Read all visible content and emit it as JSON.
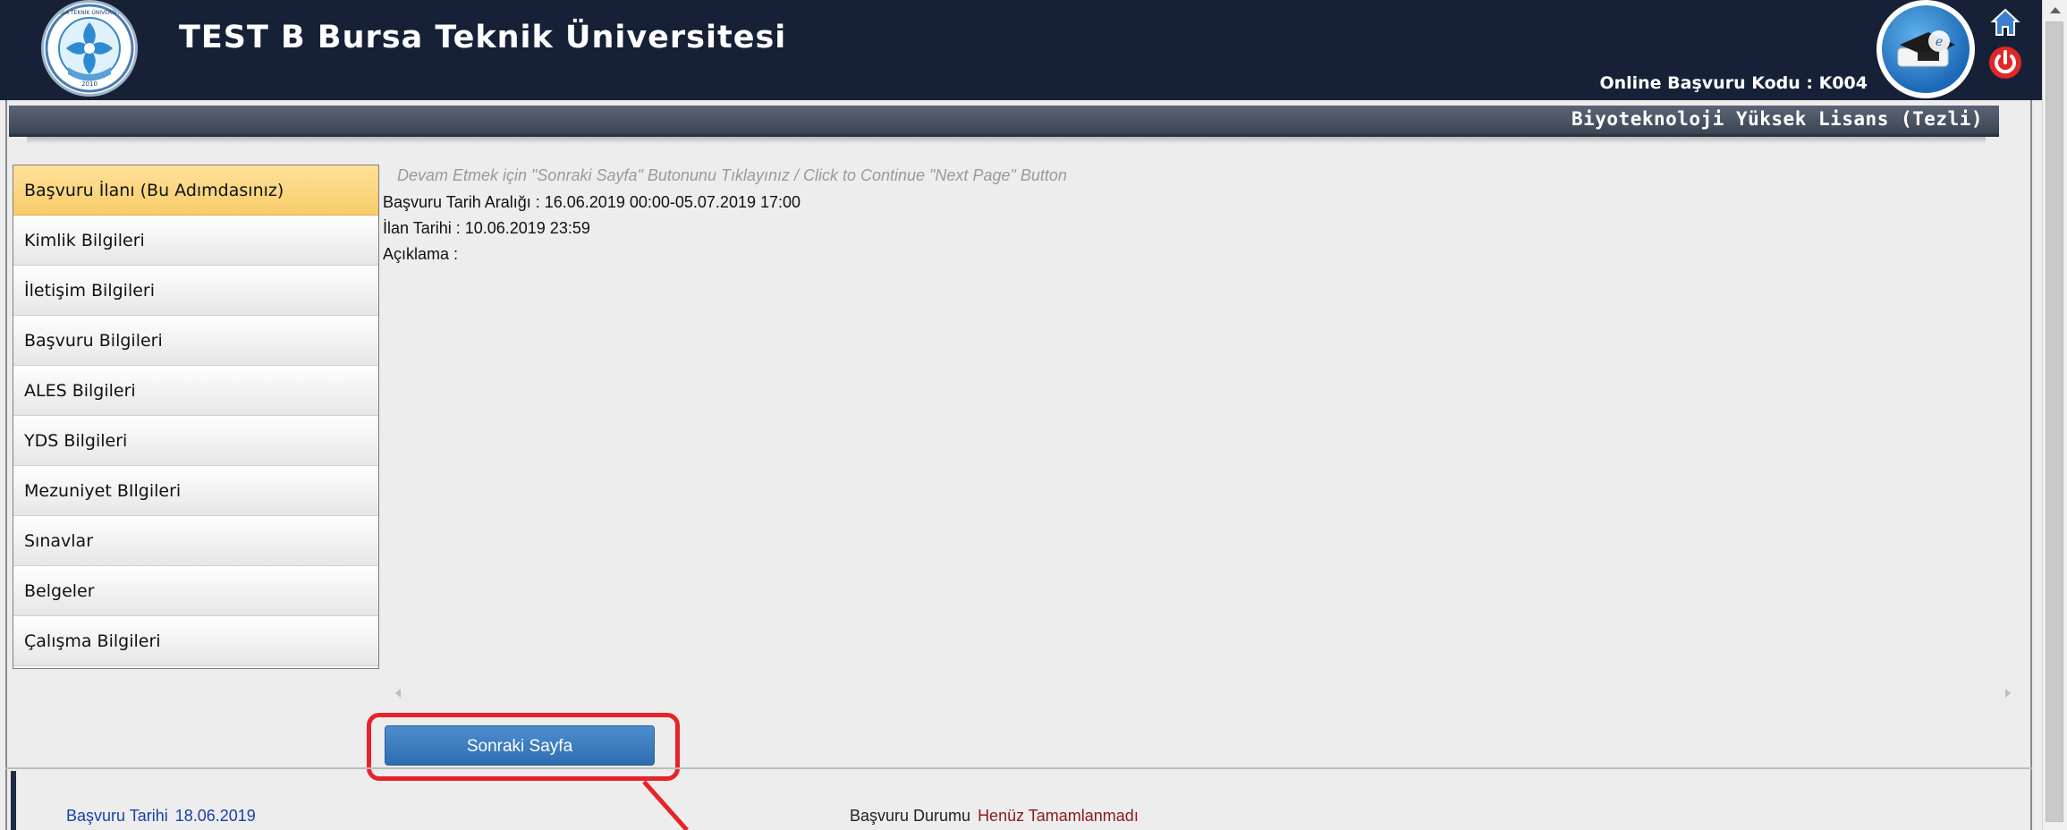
{
  "header": {
    "title": "TEST B Bursa Teknik Üniversitesi",
    "application_code": "Online Başvuru Kodu : K004",
    "program": "Biyoteknoloji Yüksek Lisans (Tezli)",
    "logo_text": "BURSA TEKNİK ÜNİVERSİTESİ",
    "logo_year": "2010"
  },
  "sidebar": {
    "items": [
      {
        "label": "Başvuru İlanı (Bu Adımdasınız)",
        "active": true
      },
      {
        "label": "Kimlik Bilgileri"
      },
      {
        "label": "İletişim Bilgileri"
      },
      {
        "label": "Başvuru Bilgileri"
      },
      {
        "label": "ALES Bilgileri"
      },
      {
        "label": "YDS Bilgileri"
      },
      {
        "label": "Mezuniyet BIlgileri"
      },
      {
        "label": "Sınavlar"
      },
      {
        "label": "Belgeler"
      },
      {
        "label": "Çalışma Bilgileri"
      }
    ]
  },
  "content": {
    "hint": "Devam Etmek için \"Sonraki Sayfa\" Butonunu Tıklayınız / Click to Continue \"Next Page\" Button",
    "date_range": "Başvuru Tarih Aralığı : 16.06.2019 00:00-05.07.2019 17:00",
    "announcement_date": "İlan Tarihi : 10.06.2019 23:59",
    "description": "Açıklama :"
  },
  "buttons": {
    "next": "Sonraki Sayfa"
  },
  "footer": {
    "application_date_label": "Başvuru Tarihi",
    "application_date_value": "18.06.2019",
    "status_label": "Başvuru Durumu",
    "status_value": "Henüz Tamamlanmadı"
  },
  "icons": {
    "home": "home-icon",
    "power": "power-icon",
    "education": "graduation-cap-icon"
  },
  "colors": {
    "header_bg": "#162137",
    "active_item": "#f7cc68",
    "button": "#2e6db0",
    "highlight": "#e8232a",
    "status_value": "#8b1a1a"
  }
}
